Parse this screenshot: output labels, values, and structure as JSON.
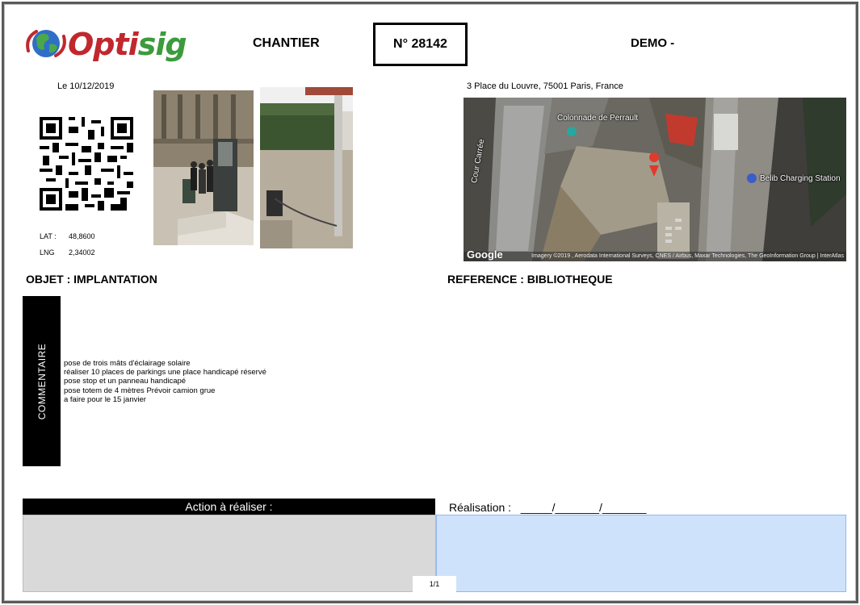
{
  "header": {
    "logo": {
      "opti": "Opti",
      "sig": "sig"
    },
    "chantier_label": "CHANTIER",
    "number": "N° 28142",
    "client": "DEMO -"
  },
  "info": {
    "date": "Le 10/12/2019",
    "lat_label": "LAT :",
    "lat_value": "48,8600",
    "lng_label": "LNG",
    "lng_value": "2,34002"
  },
  "location": {
    "address": "3 Place du Louvre, 75001 Paris, France",
    "map_labels": {
      "colonnade": "Colonnade de Perrault",
      "cour": "Cour Carrée",
      "belib": "Belib Charging Station"
    },
    "google": "Google",
    "copyright": "Imagery ©2019 , Aerodata International Surveys, CNES / Airbus, Maxar Technologies, The GeoInformation Group | InterAtlas"
  },
  "sections": {
    "objet": "OBJET : IMPLANTATION",
    "reference": "REFERENCE : BIBLIOTHEQUE",
    "comment_label": "COMMENTAIRE",
    "comment_lines": [
      "pose de trois mâts d'éclairage solaire",
      "réaliser 10 places de parkings une place handicapé réservé",
      "pose stop et un panneau handicapé",
      "pose totem de 4 mètres Prévoir camion grue",
      "a faire pour le 15 janvier"
    ]
  },
  "footer": {
    "action_label": "Action à réaliser :",
    "realisation_label": "Réalisation :",
    "realisation_date_blank": "_____/_______/_______",
    "page": "1/1"
  },
  "colors": {
    "logo_red": "#c0282d",
    "logo_green": "#3c9b3c",
    "action_fill": "#d9d9d9",
    "realisation_fill": "#cfe2fb"
  }
}
